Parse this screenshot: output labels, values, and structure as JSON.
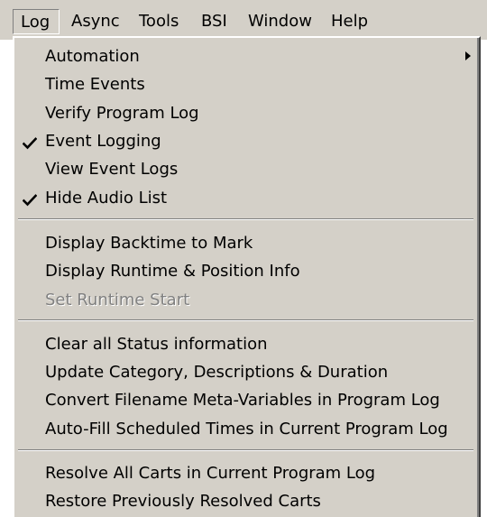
{
  "menubar": {
    "items": [
      {
        "label": "Log"
      },
      {
        "label": "Async"
      },
      {
        "label": "Tools"
      },
      {
        "label": "BSI"
      },
      {
        "label": "Window"
      },
      {
        "label": "Help"
      }
    ],
    "open_menu": "Log"
  },
  "log_menu": {
    "items": [
      {
        "label": "Automation",
        "has_submenu": true
      },
      {
        "label": "Time Events"
      },
      {
        "label": "Verify Program Log"
      },
      {
        "label": "Event Logging",
        "checked": true
      },
      {
        "label": "View Event Logs"
      },
      {
        "label": "Hide Audio List",
        "checked": true
      },
      {
        "label": "Display Backtime to Mark"
      },
      {
        "label": "Display Runtime & Position Info"
      },
      {
        "label": "Set Runtime Start",
        "disabled": true
      },
      {
        "label": "Clear all Status information"
      },
      {
        "label": "Update Category, Descriptions & Duration"
      },
      {
        "label": "Convert Filename Meta-Variables in Program Log"
      },
      {
        "label": "Auto-Fill Scheduled Times in Current Program Log"
      },
      {
        "label": "Resolve All Carts in Current Program Log"
      },
      {
        "label": "Restore Previously Resolved Carts"
      }
    ]
  },
  "icons": {
    "check": "check-icon",
    "submenu_arrow": "submenu-arrow-icon"
  },
  "colors": {
    "menu_background": "#d4d0c8",
    "disabled_text": "#808080"
  }
}
